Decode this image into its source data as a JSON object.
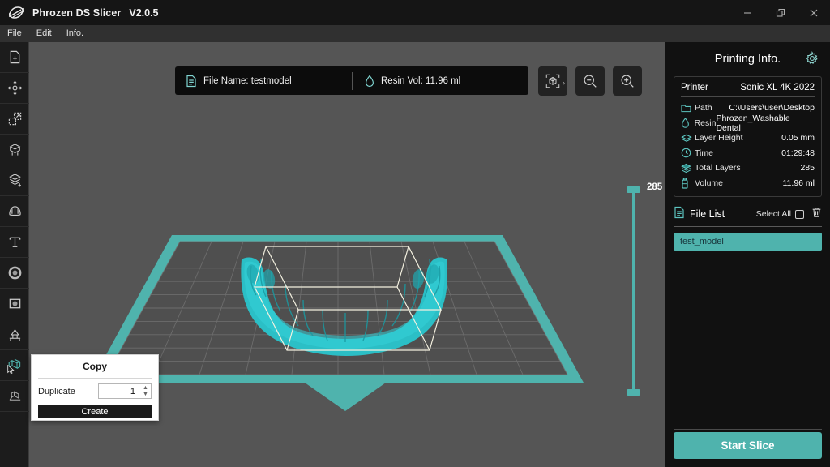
{
  "window": {
    "app_title": "Phrozen DS Slicer",
    "version": "V2.0.5",
    "logo_icon": "phrozen-logo-icon",
    "minimize_icon": "minimize-icon",
    "restore_icon": "restore-icon",
    "close_icon": "close-icon"
  },
  "menubar": {
    "items": [
      {
        "label": "File"
      },
      {
        "label": "Edit"
      },
      {
        "label": "Info."
      }
    ]
  },
  "left_toolbar": {
    "tools": [
      {
        "name": "add-file",
        "icon": "file-plus-icon",
        "active": false
      },
      {
        "name": "move",
        "icon": "move-arrows-icon",
        "active": false
      },
      {
        "name": "scale",
        "icon": "scale-resize-icon",
        "active": false
      },
      {
        "name": "support",
        "icon": "support-cube-icon",
        "active": false
      },
      {
        "name": "layers",
        "icon": "layers-stack-icon",
        "active": false
      },
      {
        "name": "dental-arch",
        "icon": "dental-arch-icon",
        "active": false
      },
      {
        "name": "text-label",
        "icon": "text-t-icon",
        "active": false
      },
      {
        "name": "hollow",
        "icon": "hollow-ring-icon",
        "active": false
      },
      {
        "name": "drain-hole",
        "icon": "drain-hole-icon",
        "active": false
      },
      {
        "name": "raft",
        "icon": "raft-base-icon",
        "active": false
      },
      {
        "name": "copy",
        "icon": "copy-cubes-icon",
        "active": true
      },
      {
        "name": "mirror",
        "icon": "mirror-cube-icon",
        "active": false
      }
    ]
  },
  "viewport": {
    "infobar": {
      "file_icon": "document-icon",
      "file_label": "File Name: testmodel",
      "resin_icon": "droplet-icon",
      "resin_label": "Resin Vol:  11.96 ml"
    },
    "view_buttons": [
      {
        "name": "fit-view",
        "icon": "cube-frame-icon",
        "chevron": "›"
      },
      {
        "name": "zoom-out",
        "icon": "zoom-out-icon"
      },
      {
        "name": "zoom-in",
        "icon": "zoom-in-icon"
      }
    ],
    "layer_slider": {
      "max_label": "285",
      "top_handle": "slider-handle-top",
      "bottom_handle": "slider-handle-bottom"
    },
    "model": {
      "name": "dental-arch-model",
      "color": "#27c6cd",
      "selected": true
    },
    "plate_color": "#4fb3ad",
    "grid_color": "#6a6a6a"
  },
  "copy_dialog": {
    "title": "Copy",
    "duplicate_label": "Duplicate",
    "duplicate_value": "1",
    "create_label": "Create"
  },
  "right_panel": {
    "title": "Printing Info.",
    "gear_icon": "gear-icon",
    "printer_key": "Printer",
    "printer_value": "Sonic XL 4K 2022",
    "info_rows": [
      {
        "icon": "folder-icon",
        "key": "Path",
        "value": "C:\\Users\\user\\Desktop"
      },
      {
        "icon": "droplet-icon",
        "key": "Resin",
        "value": "Phrozen_Washable Dental"
      },
      {
        "icon": "layer-height-icon",
        "key": "Layer Height",
        "value": "0.05 mm"
      },
      {
        "icon": "clock-icon",
        "key": "Time",
        "value": "01:29:48"
      },
      {
        "icon": "layers-stack-icon",
        "key": "Total Layers",
        "value": "285"
      },
      {
        "icon": "bottle-icon",
        "key": "Volume",
        "value": "11.96 ml"
      }
    ],
    "file_list": {
      "icon": "list-document-icon",
      "title": "File List",
      "select_all_label": "Select All",
      "checkbox_icon": "checkbox-icon",
      "trash_icon": "trash-icon",
      "items": [
        {
          "name": "test_model",
          "selected": true
        }
      ]
    },
    "start_slice_label": "Start Slice"
  },
  "colors": {
    "accent_teal": "#4fb3ad",
    "model_cyan": "#27c6cd",
    "panel_bg": "#111111",
    "viewport_bg": "#555555"
  }
}
